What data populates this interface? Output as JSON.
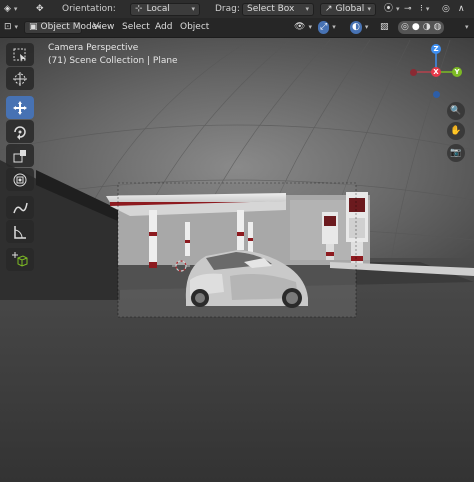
{
  "header": {
    "orientation_label": "Orientation:",
    "orientation_value": "Local",
    "drag_label": "Drag:",
    "drag_value": "Select Box",
    "transform_value": "Global"
  },
  "subheader": {
    "mode": "Object Mode",
    "menus": [
      "View",
      "Select",
      "Add",
      "Object"
    ]
  },
  "overlay": {
    "title": "Camera Perspective",
    "subtitle": "(71) Scene Collection | Plane"
  },
  "gizmo": {
    "x": "X",
    "y": "Y",
    "z": "Z"
  },
  "colors": {
    "accent": "#4772b3",
    "axis_x": "#e6394a",
    "axis_y": "#7dbb24",
    "axis_z": "#3f8ff0"
  },
  "icons": {
    "tools": [
      "select-box-icon",
      "cursor-icon",
      "move-icon",
      "rotate-icon",
      "scale-icon",
      "transform-icon",
      "annotate-icon",
      "measure-icon",
      "add-cube-icon"
    ]
  }
}
